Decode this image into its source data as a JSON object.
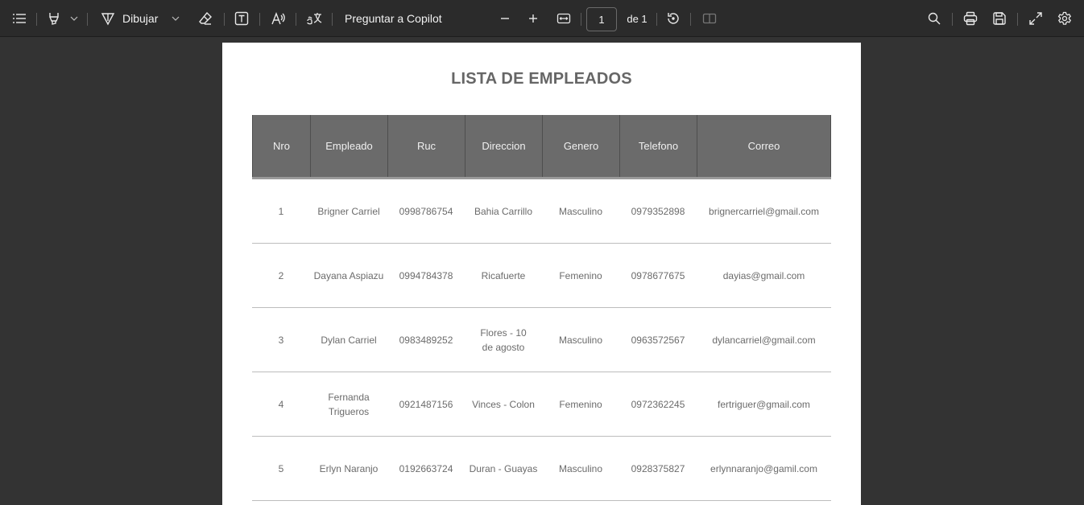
{
  "toolbar": {
    "draw_label": "Dibujar",
    "copilot_label": "Preguntar a Copilot",
    "page_current": "1",
    "page_total": "de 1"
  },
  "icons": [
    "contents-icon",
    "highlight-icon",
    "chevron-down-icon",
    "draw-icon",
    "eraser-icon",
    "text-box-icon",
    "read-aloud-icon",
    "translate-icon",
    "zoom-out-icon",
    "zoom-in-icon",
    "fit-width-icon",
    "rotate-icon",
    "two-page-icon",
    "search-icon",
    "print-icon",
    "save-icon",
    "fullscreen-icon",
    "settings-icon"
  ],
  "document": {
    "title": "LISTA DE EMPLEADOS",
    "headers": [
      "Nro",
      "Empleado",
      "Ruc",
      "Direccion",
      "Genero",
      "Telefono",
      "Correo"
    ],
    "rows": [
      [
        "1",
        "Brigner Carriel",
        "0998786754",
        "Bahia Carrillo",
        "Masculino",
        "0979352898",
        "brignercarriel@gmail.com"
      ],
      [
        "2",
        "Dayana Aspiazu",
        "0994784378",
        "Ricafuerte",
        "Femenino",
        "0978677675",
        "dayias@gmail.com"
      ],
      [
        "3",
        "Dylan Carriel",
        "0983489252",
        "Flores - 10 de agosto",
        "Masculino",
        "0963572567",
        "dylancarriel@gmail.com"
      ],
      [
        "4",
        "Fernanda Trigueros",
        "0921487156",
        "Vinces - Colon",
        "Femenino",
        "0972362245",
        "fertriguer@gmail.com"
      ],
      [
        "5",
        "Erlyn Naranjo",
        "0192663724",
        "Duran - Guayas",
        "Masculino",
        "0928375827",
        "erlynnaranjo@gamil.com"
      ]
    ]
  }
}
